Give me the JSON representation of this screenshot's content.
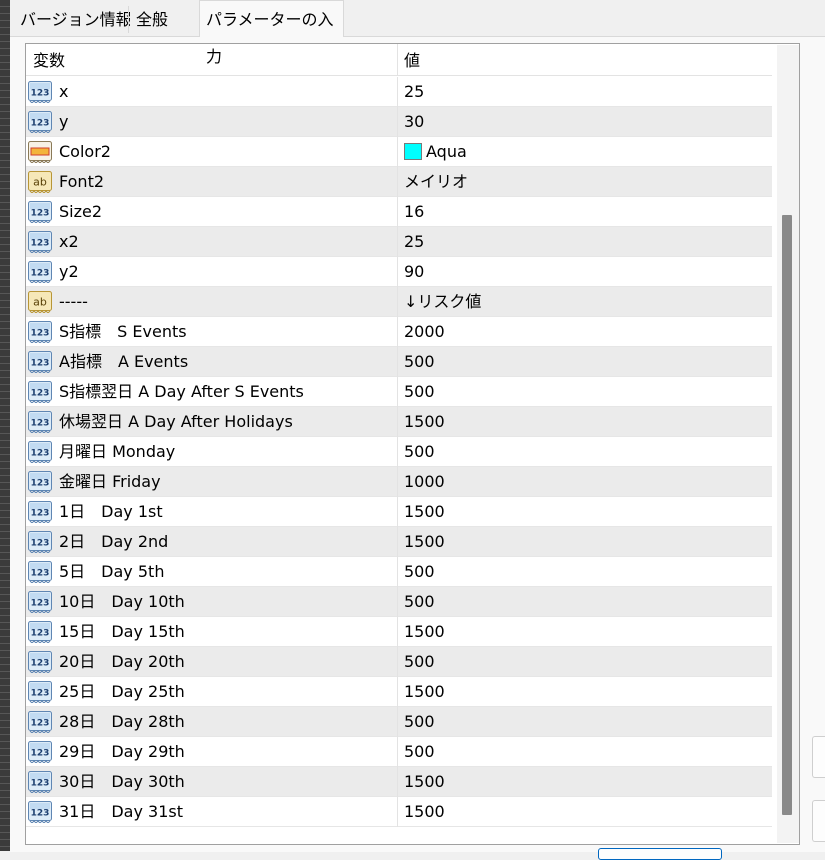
{
  "tabs": [
    {
      "label": "バージョン情報",
      "active": false
    },
    {
      "label": "全般",
      "active": false
    },
    {
      "label": "パラメーターの入力",
      "active": true
    }
  ],
  "grid": {
    "columns": [
      "変数",
      "値"
    ],
    "rows": [
      {
        "icon": "integer-icon",
        "name": "x",
        "value": "25"
      },
      {
        "icon": "integer-icon",
        "name": "y",
        "value": "30"
      },
      {
        "icon": "color-icon",
        "name": "Color2",
        "value": "Aqua",
        "swatch": "#00ffff"
      },
      {
        "icon": "string-icon",
        "name": "Font2",
        "value": "メイリオ"
      },
      {
        "icon": "integer-icon",
        "name": "Size2",
        "value": "16"
      },
      {
        "icon": "integer-icon",
        "name": "x2",
        "value": "25"
      },
      {
        "icon": "integer-icon",
        "name": "y2",
        "value": "90"
      },
      {
        "icon": "string-icon",
        "name": "-----",
        "value": "↓リスク値"
      },
      {
        "icon": "integer-icon",
        "name": "S指標　S Events",
        "value": "2000"
      },
      {
        "icon": "integer-icon",
        "name": "A指標　A Events",
        "value": "500"
      },
      {
        "icon": "integer-icon",
        "name": "S指標翌日 A Day After S Events",
        "value": "500"
      },
      {
        "icon": "integer-icon",
        "name": "休場翌日 A Day After Holidays",
        "value": "1500"
      },
      {
        "icon": "integer-icon",
        "name": "月曜日 Monday",
        "value": "500"
      },
      {
        "icon": "integer-icon",
        "name": "金曜日 Friday",
        "value": "1000"
      },
      {
        "icon": "integer-icon",
        "name": "1日　Day 1st",
        "value": "1500"
      },
      {
        "icon": "integer-icon",
        "name": "2日　Day 2nd",
        "value": "1500"
      },
      {
        "icon": "integer-icon",
        "name": "5日　Day 5th",
        "value": "500"
      },
      {
        "icon": "integer-icon",
        "name": "10日　Day 10th",
        "value": "500"
      },
      {
        "icon": "integer-icon",
        "name": "15日　Day 15th",
        "value": "1500"
      },
      {
        "icon": "integer-icon",
        "name": "20日　Day 20th",
        "value": "500"
      },
      {
        "icon": "integer-icon",
        "name": "25日　Day 25th",
        "value": "1500"
      },
      {
        "icon": "integer-icon",
        "name": "28日　Day 28th",
        "value": "500"
      },
      {
        "icon": "integer-icon",
        "name": "29日　Day 29th",
        "value": "500"
      },
      {
        "icon": "integer-icon",
        "name": "30日　Day 30th",
        "value": "1500"
      },
      {
        "icon": "integer-icon",
        "name": "31日　Day 31st",
        "value": "1500"
      }
    ]
  },
  "icon_glyphs": {
    "integer": "123",
    "string": "ab"
  }
}
